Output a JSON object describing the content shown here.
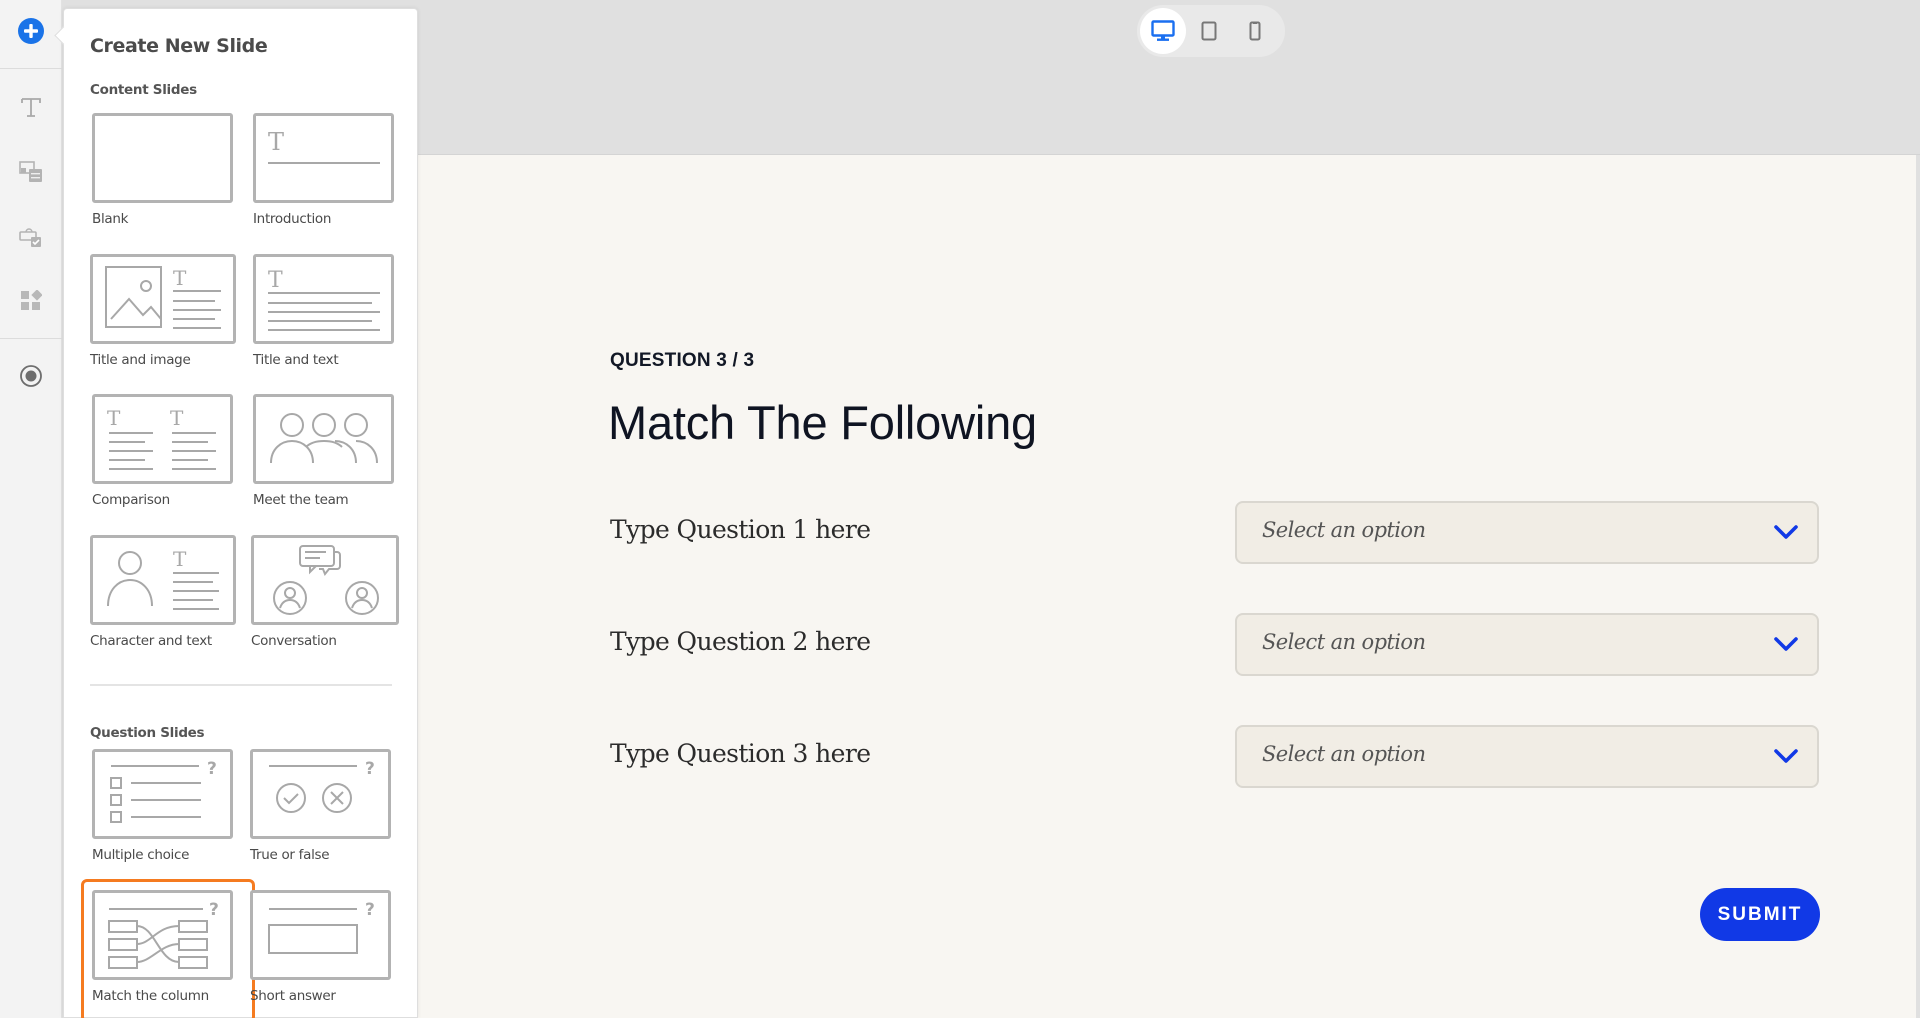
{
  "rail": {
    "items": [
      {
        "icon": "add-circle-icon",
        "label": "Add slide"
      },
      {
        "icon": "text-icon",
        "label": "Text"
      },
      {
        "icon": "media-icon",
        "label": "Media"
      },
      {
        "icon": "interaction-icon",
        "label": "Interactions"
      },
      {
        "icon": "widgets-icon",
        "label": "Widgets"
      },
      {
        "icon": "record-icon",
        "label": "Record"
      }
    ]
  },
  "panel": {
    "title": "Create New Slide",
    "content_section": "Content Slides",
    "question_section": "Question Slides",
    "content_slides": [
      {
        "id": "blank",
        "label": "Blank"
      },
      {
        "id": "introduction",
        "label": "Introduction"
      },
      {
        "id": "title-image",
        "label": "Title and image"
      },
      {
        "id": "title-text",
        "label": "Title and text"
      },
      {
        "id": "comparison",
        "label": "Comparison"
      },
      {
        "id": "meet-team",
        "label": "Meet the team"
      },
      {
        "id": "character-text",
        "label": "Character and text"
      },
      {
        "id": "conversation",
        "label": "Conversation"
      }
    ],
    "question_slides": [
      {
        "id": "multiple-choice",
        "label": "Multiple choice"
      },
      {
        "id": "true-false",
        "label": "True or false"
      },
      {
        "id": "match-column",
        "label": "Match the column",
        "selected": true
      },
      {
        "id": "short-answer",
        "label": "Short answer"
      }
    ]
  },
  "device_bar": {
    "devices": [
      {
        "id": "desktop",
        "icon": "desktop-icon",
        "active": true
      },
      {
        "id": "tablet",
        "icon": "tablet-icon",
        "active": false
      },
      {
        "id": "mobile",
        "icon": "mobile-icon",
        "active": false
      }
    ],
    "active_color": "#1a6ff0"
  },
  "slide": {
    "counter": "QUESTION 3 / 3",
    "title": "Match The Following",
    "questions": [
      {
        "text": "Type Question 1 here",
        "select_placeholder": "Select an option"
      },
      {
        "text": "Type Question 2 here",
        "select_placeholder": "Select an option"
      },
      {
        "text": "Type Question 3 here",
        "select_placeholder": "Select an option"
      }
    ],
    "submit_label": "SUBMIT",
    "accent_color": "#1139e6",
    "selected_tile_color": "#f57b20"
  }
}
